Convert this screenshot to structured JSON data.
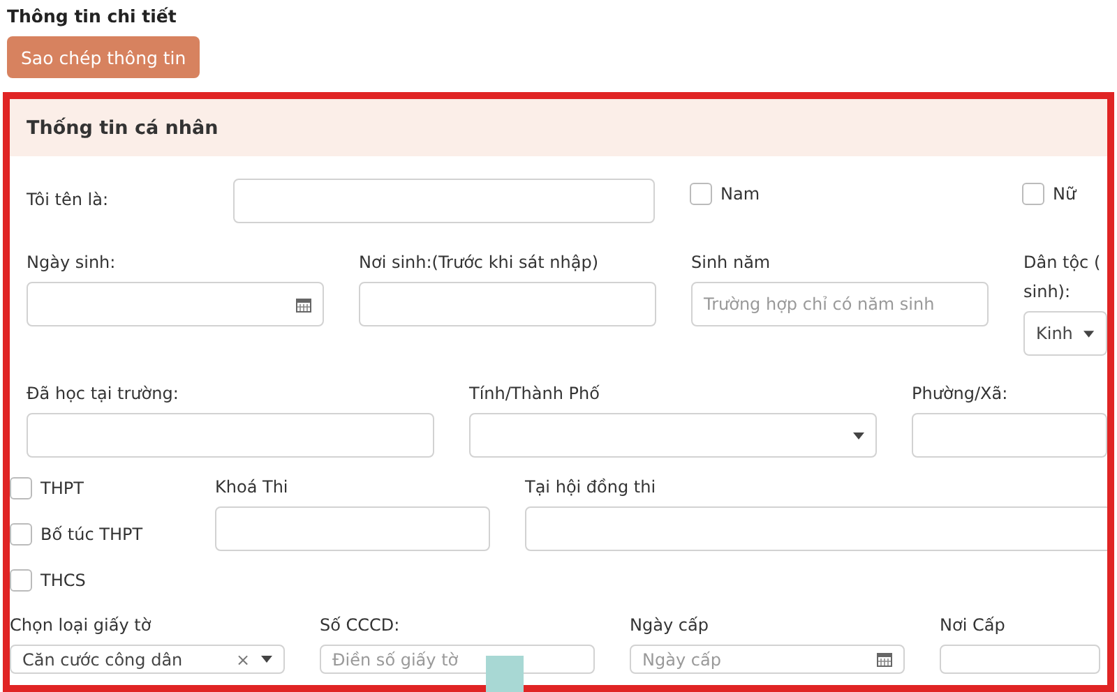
{
  "title": "Thông tin chi tiết",
  "copy_button": "Sao chép thông tin",
  "section": {
    "title": "Thống tin cá nhân",
    "name_row": {
      "label": "Tôi tên là:",
      "genders": [
        {
          "label": "Nam",
          "checked": false
        },
        {
          "label": "Nữ",
          "checked": false
        }
      ]
    },
    "birth_row": [
      {
        "label": "Ngày sinh:",
        "kind": "date"
      },
      {
        "label": "Nơi sinh:(Trước khi sát nhập)",
        "kind": "text"
      },
      {
        "label": "Sinh năm",
        "kind": "text",
        "placeholder": "Trường hợp chỉ có năm sinh"
      },
      {
        "label": "Dân tộc (",
        "label_continued": "sinh):",
        "kind": "select",
        "value": "Kinh"
      }
    ],
    "school_row": [
      {
        "label": "Đã học tại trường:",
        "kind": "text"
      },
      {
        "label": "Tính/Thành Phố",
        "kind": "select"
      },
      {
        "label": "Phường/Xã:",
        "kind": "text"
      }
    ],
    "levels": [
      {
        "label": "THPT",
        "checked": false
      },
      {
        "label": "Bố túc THPT",
        "checked": false
      },
      {
        "label": "THCS",
        "checked": false
      }
    ],
    "exam_row": [
      {
        "label": "Khoá Thi",
        "kind": "text"
      },
      {
        "label": "Tại hội đồng thi",
        "kind": "text"
      }
    ],
    "id_row": [
      {
        "label": "Chọn loại giấy tờ",
        "kind": "clearable-select",
        "value": "Căn cước công dân",
        "clear": "×"
      },
      {
        "label": "Số CCCD:",
        "kind": "text",
        "placeholder": "Điền số giấy tờ"
      },
      {
        "label": "Ngày cấp",
        "kind": "date",
        "placeholder": "Ngày cấp"
      },
      {
        "label": "Nơi Cấp",
        "kind": "text"
      }
    ]
  }
}
